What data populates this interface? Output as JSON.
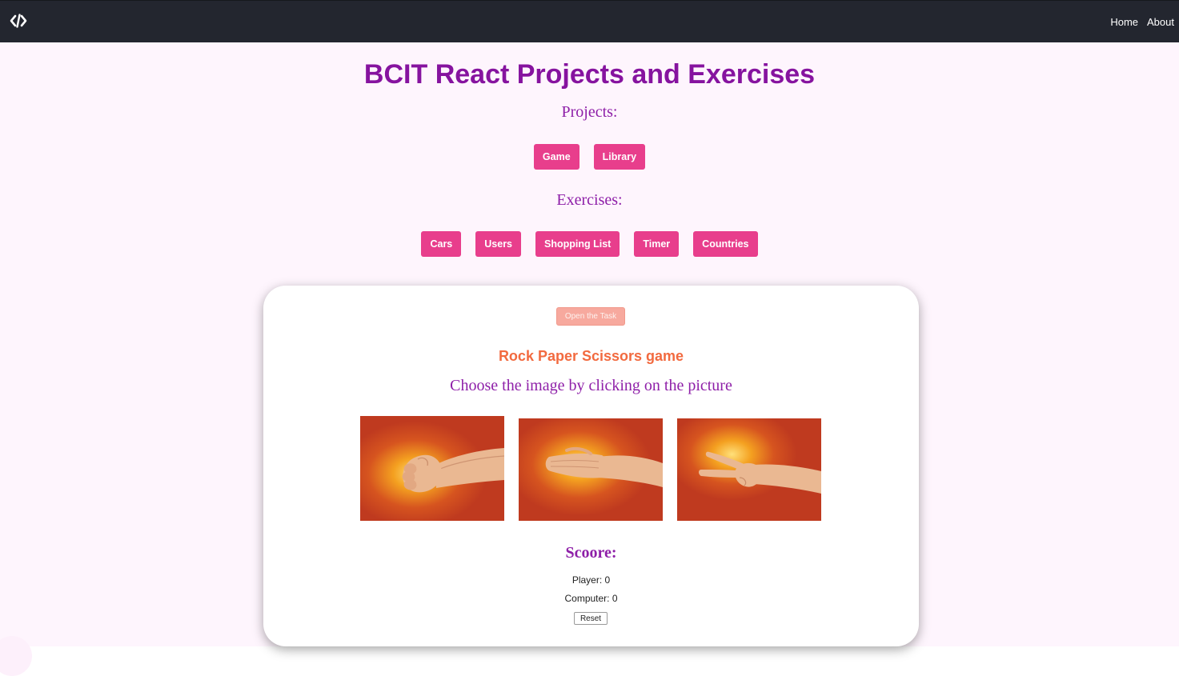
{
  "navbar": {
    "logo_icon": "code-brackets-icon",
    "links": [
      "Home",
      "About"
    ]
  },
  "page": {
    "title": "BCIT React Projects and Exercises",
    "projects_heading": "Projects:",
    "projects": [
      "Game",
      "Library"
    ],
    "exercises_heading": "Exercises:",
    "exercises": [
      "Cars",
      "Users",
      "Shopping List",
      "Timer",
      "Countries"
    ]
  },
  "game": {
    "task_button": "Open the Task",
    "title": "Rock Paper Scissors game",
    "instruction": "Choose the image by clicking on the picture",
    "choices": [
      "rock",
      "paper",
      "scissors"
    ],
    "score_heading": "Scoore:",
    "player_score": "Player: 0",
    "computer_score": "Computer: 0",
    "reset_button": "Reset"
  },
  "colors": {
    "navbar_bg": "#23262f",
    "page_bg": "#fef5fd",
    "title": "#86139f",
    "heading": "#8e1fa8",
    "pink_button": "#e83e8c",
    "task_button": "#f7a99e",
    "game_title": "#f26a3f",
    "image_bg": "#c0391f"
  }
}
